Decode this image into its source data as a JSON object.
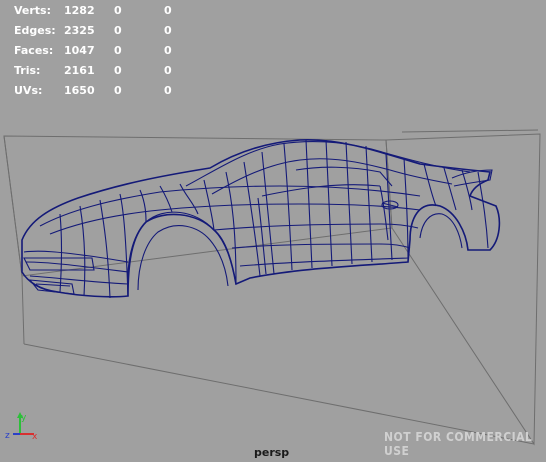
{
  "hud": {
    "rows": [
      {
        "label": "Verts:",
        "a": "1282",
        "b": "0",
        "c": "0"
      },
      {
        "label": "Edges:",
        "a": "2325",
        "b": "0",
        "c": "0"
      },
      {
        "label": "Faces:",
        "a": "1047",
        "b": "0",
        "c": "0"
      },
      {
        "label": "Tris:",
        "a": "2161",
        "b": "0",
        "c": "0"
      },
      {
        "label": "UVs:",
        "a": "1650",
        "b": "0",
        "c": "0"
      }
    ]
  },
  "viewport": {
    "camera": "persp",
    "watermark": "NOT FOR COMMERCIAL USE",
    "background": "#a0a0a0",
    "wireframe_color": "#141a78"
  },
  "axes": {
    "x": "x",
    "y": "y",
    "z": "z"
  }
}
